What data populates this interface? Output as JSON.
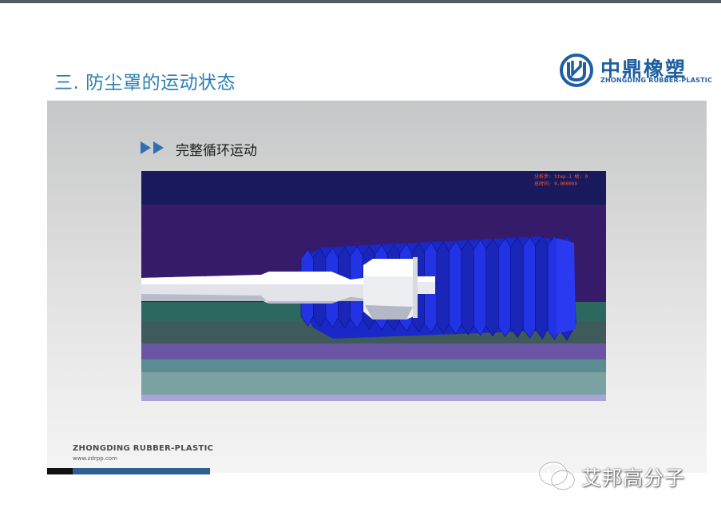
{
  "slide": {
    "title": "三. 防尘罩的运动状态",
    "subtitle": "完整循环运动"
  },
  "logo": {
    "name_cn": "中鼎橡塑",
    "name_en": "ZHONGDING RUBBER-PLASTIC",
    "icon": "zhongding-logo-icon"
  },
  "simulation": {
    "readout_line1": "分析步: Step-1    帧: 0",
    "readout_line2": "总时间: 0.000000"
  },
  "footer": {
    "brand": "ZHONGDING RUBBER-PLASTIC",
    "url": "www.zdrpp.com"
  },
  "watermark": {
    "text": "艾邦高分子",
    "icon": "wechat-icon"
  },
  "colors": {
    "title": "#2a7fb1",
    "brand_blue": "#1e5fa0",
    "boot_blue": "#2233e6",
    "footer_blue": "#2f5f93"
  }
}
